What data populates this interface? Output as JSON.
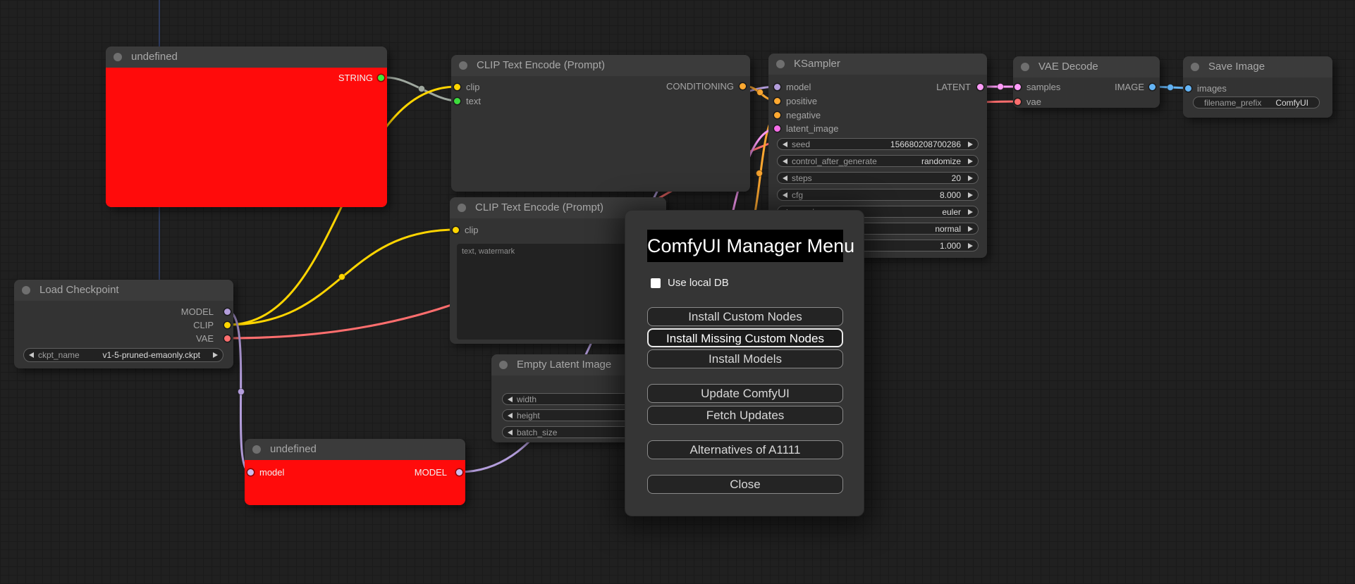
{
  "app_title": "ComfyUI",
  "colors": {
    "canvas_bg": "#202020",
    "node_bg": "#333333",
    "node_title_bg": "#3b3b3b",
    "error_node_bg": "#ff0b0b",
    "wire_clip": "#FFD500",
    "wire_model": "#B39DDB",
    "wire_vae": "#FF6E6E",
    "wire_conditioning": "#FFA931",
    "wire_latent": "#FF9CF9",
    "wire_image": "#64B5F6",
    "wire_string": "#9FA89F",
    "slot_green": "#3DDC3D"
  },
  "nodes": {
    "undefined_top": {
      "title": "undefined",
      "output_label": "STRING"
    },
    "clip_encode_1": {
      "title": "CLIP Text Encode (Prompt)",
      "inputs": [
        {
          "label": "clip"
        },
        {
          "label": "text"
        }
      ],
      "output_label": "CONDITIONING"
    },
    "clip_encode_2": {
      "title": "CLIP Text Encode (Prompt)",
      "inputs": [
        {
          "label": "clip"
        }
      ],
      "prompt_text": "text, watermark"
    },
    "ksampler": {
      "title": "KSampler",
      "inputs": [
        {
          "label": "model"
        },
        {
          "label": "positive"
        },
        {
          "label": "negative"
        },
        {
          "label": "latent_image"
        }
      ],
      "output_label": "LATENT",
      "widgets": [
        {
          "label": "seed",
          "value": "156680208700286"
        },
        {
          "label": "control_after_generate",
          "value": "randomize"
        },
        {
          "label": "steps",
          "value": "20"
        },
        {
          "label": "cfg",
          "value": "8.000"
        },
        {
          "label": "sampler_name",
          "value": "euler"
        },
        {
          "label": "",
          "value": "normal"
        },
        {
          "label": "",
          "value": "1.000"
        }
      ]
    },
    "vae_decode": {
      "title": "VAE Decode",
      "inputs": [
        {
          "label": "samples"
        },
        {
          "label": "vae"
        }
      ],
      "output_label": "IMAGE"
    },
    "save_image": {
      "title": "Save Image",
      "inputs": [
        {
          "label": "images"
        }
      ],
      "widgets": [
        {
          "label": "filename_prefix",
          "value": "ComfyUI"
        }
      ]
    },
    "load_checkpoint": {
      "title": "Load Checkpoint",
      "outputs": [
        {
          "label": "MODEL"
        },
        {
          "label": "CLIP"
        },
        {
          "label": "VAE"
        }
      ],
      "widgets": [
        {
          "label": "ckpt_name",
          "value": "v1-5-pruned-emaonly.ckpt"
        }
      ]
    },
    "empty_latent": {
      "title": "Empty Latent Image",
      "widgets": [
        {
          "label": "width",
          "value": ""
        },
        {
          "label": "height",
          "value": ""
        },
        {
          "label": "batch_size",
          "value": ""
        }
      ]
    },
    "undefined_bottom": {
      "title": "undefined",
      "inputs": [
        {
          "label": "model"
        }
      ],
      "output_label": "MODEL"
    }
  },
  "dialog": {
    "title": "ComfyUI Manager Menu",
    "checkbox_label": "Use local DB",
    "checkbox_checked": "false",
    "buttons": [
      "Install Custom Nodes",
      "Install Missing Custom Nodes",
      "Install Models",
      "Update ComfyUI",
      "Fetch Updates",
      "Alternatives of A1111",
      "Close"
    ],
    "highlighted_button": "Install Missing Custom Nodes"
  }
}
